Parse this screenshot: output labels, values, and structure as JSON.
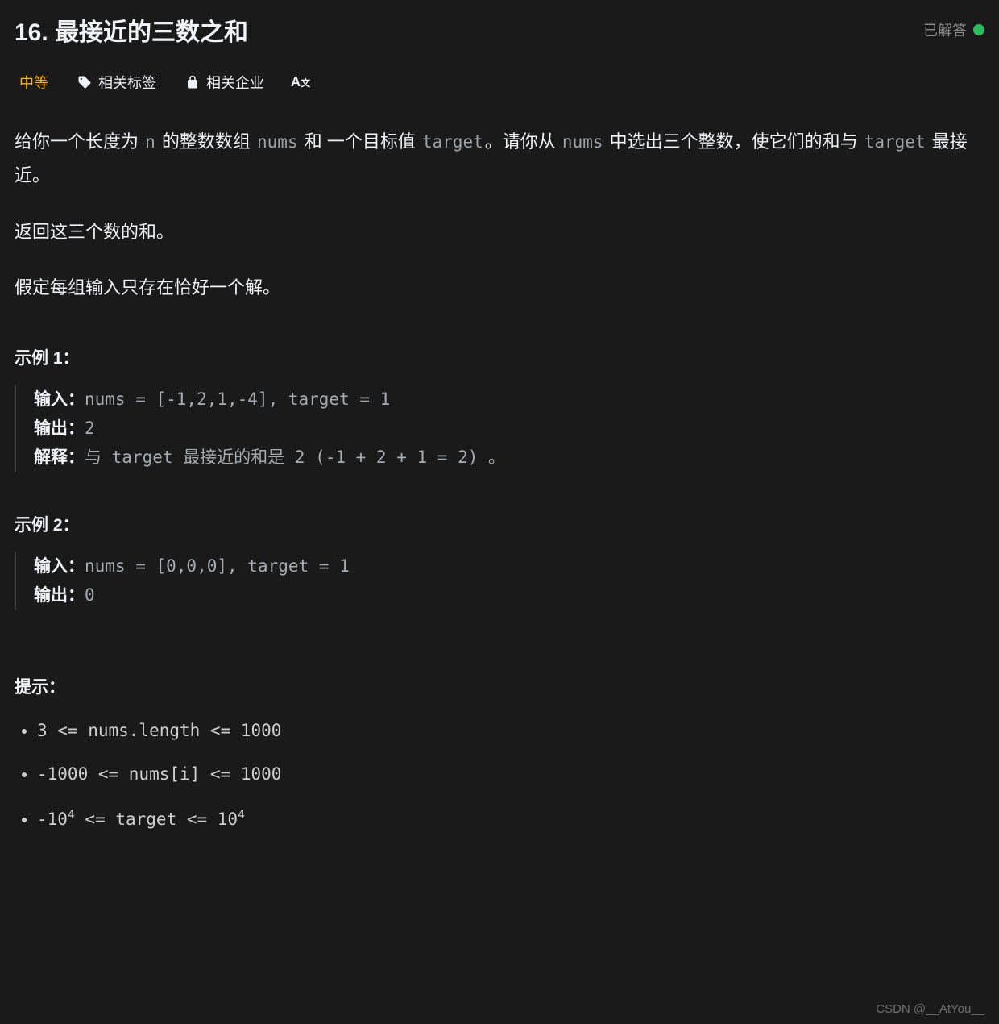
{
  "header": {
    "title": "16. 最接近的三数之和",
    "solved_label": "已解答"
  },
  "meta": {
    "difficulty": "中等",
    "tags_label": "相关标签",
    "companies_label": "相关企业"
  },
  "description": {
    "p1_a": "给你一个长度为 ",
    "code_n": "n",
    "p1_b": " 的整数数组 ",
    "code_nums": "nums",
    "p1_c": " 和 一个目标值 ",
    "code_target": "target",
    "p1_d": "。请你从 ",
    "code_nums2": "nums",
    "p1_e": " 中选出三个整数，使它们的和与 ",
    "code_target2": "target",
    "p1_f": " 最接近。",
    "p2": "返回这三个数的和。",
    "p3": "假定每组输入只存在恰好一个解。"
  },
  "examples": [
    {
      "title": "示例 1：",
      "input_label": "输入：",
      "input_value": "nums = [-1,2,1,-4], target = 1",
      "output_label": "输出：",
      "output_value": "2",
      "explain_label": "解释：",
      "explain_value": "与 target 最接近的和是 2 (-1 + 2 + 1 = 2) 。"
    },
    {
      "title": "示例 2：",
      "input_label": "输入：",
      "input_value": "nums = [0,0,0], target = 1",
      "output_label": "输出：",
      "output_value": "0",
      "explain_label": "",
      "explain_value": ""
    }
  ],
  "hints": {
    "title": "提示：",
    "items": [
      "3 <= nums.length <= 1000",
      "-1000 <= nums[i] <= 1000",
      "-10^4 <= target <= 10^4"
    ]
  },
  "watermark": "CSDN @__AtYou__"
}
